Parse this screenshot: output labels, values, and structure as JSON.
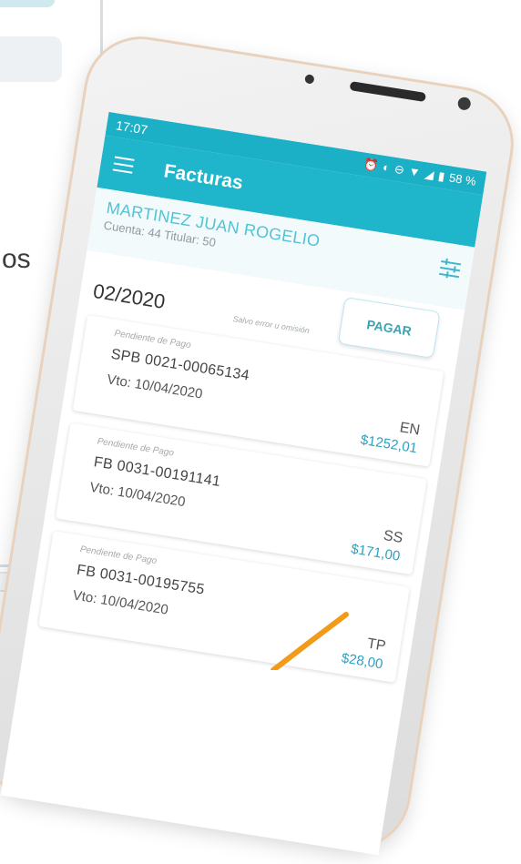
{
  "background": {
    "partial_text": "os"
  },
  "statusbar": {
    "time": "17:07",
    "battery": "58 %"
  },
  "appbar": {
    "title": "Facturas"
  },
  "account": {
    "name": "MARTINEZ JUAN ROGELIO",
    "details": "Cuenta: 44  Titular: 50"
  },
  "period": {
    "label": "02/2020",
    "disclaimer": "Salvo error u omisión",
    "pay_label": "PAGAR"
  },
  "invoices": [
    {
      "status": "Pendiente de Pago",
      "number": "SPB 0021-00065134",
      "due": "Vto: 10/04/2020",
      "code": "EN",
      "amount": "$1252,01"
    },
    {
      "status": "Pendiente de Pago",
      "number": "FB 0031-00191141",
      "due": "Vto: 10/04/2020",
      "code": "SS",
      "amount": "$171,00"
    },
    {
      "status": "Pendiente de Pago",
      "number": "FB 0031-00195755",
      "due": "Vto: 10/04/2020",
      "code": "TP",
      "amount": "$28,00"
    }
  ],
  "colors": {
    "primary": "#1fb5cb",
    "accent": "#f29a1a",
    "amount": "#2f9fc0"
  }
}
